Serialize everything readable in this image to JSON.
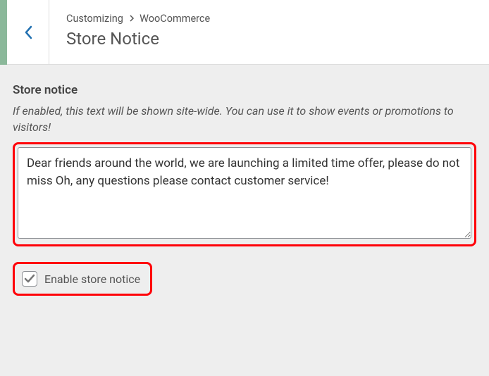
{
  "breadcrumb": {
    "root": "Customizing",
    "parent": "WooCommerce"
  },
  "page_title": "Store Notice",
  "section": {
    "label": "Store notice",
    "description": "If enabled, this text will be shown site-wide. You can use it to show events or promotions to visitors!",
    "textarea_value": "Dear friends around the world, we are launching a limited time offer, please do not miss Oh, any questions please contact customer service!"
  },
  "checkbox": {
    "label": "Enable store notice",
    "checked": true
  },
  "colors": {
    "highlight": "#ff0008",
    "back_arrow": "#2271b1",
    "accent_stripe": "#8bb89a"
  }
}
